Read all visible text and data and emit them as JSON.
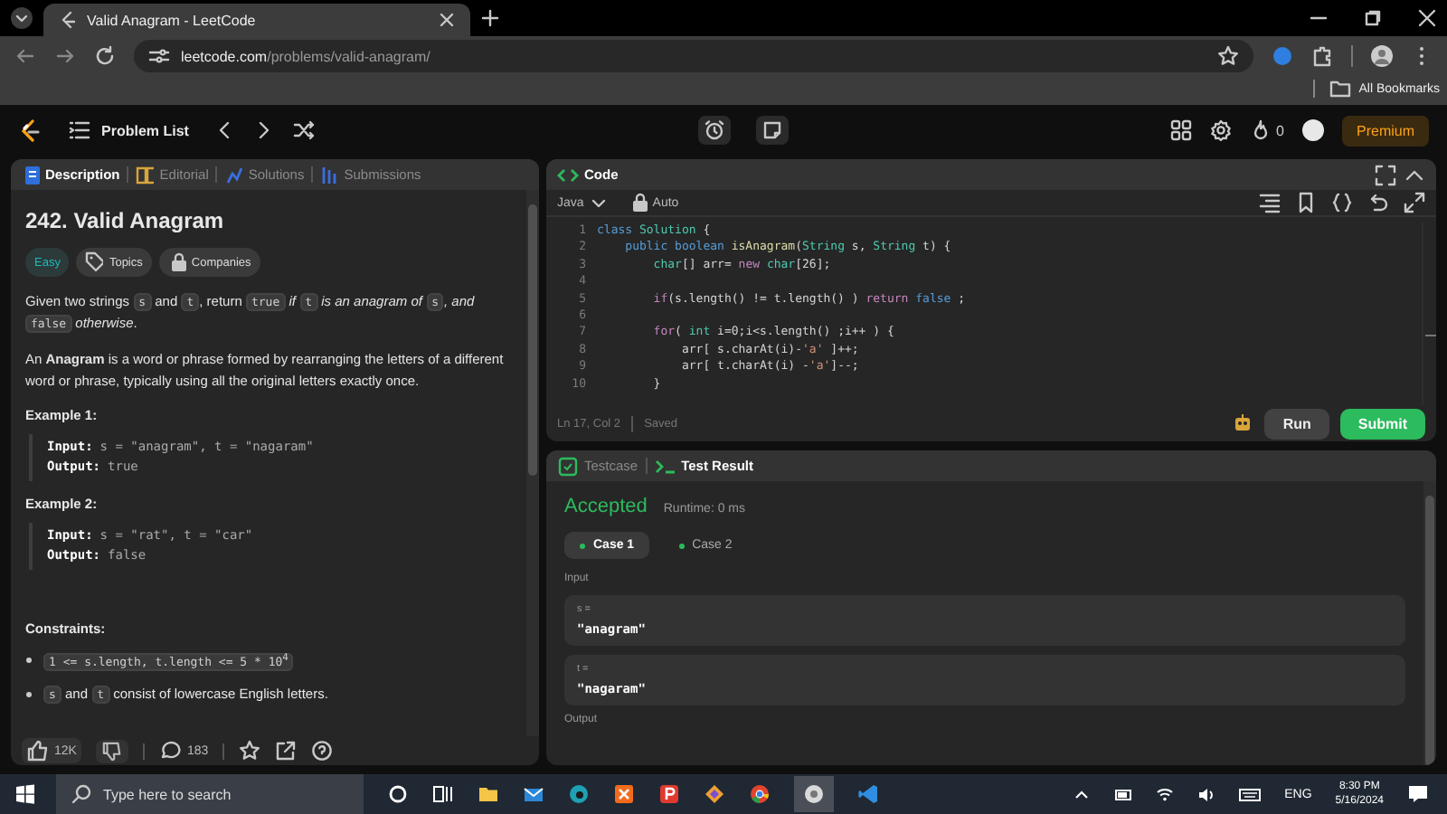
{
  "browser": {
    "tabs": [
      {
        "title": "Valid Anagram - LeetCode",
        "selected": true
      }
    ],
    "address": {
      "host": "leetcode.com",
      "path": "/problems/valid-anagram/"
    },
    "bookmarks_label": "All Bookmarks"
  },
  "nav": {
    "title": "Problem List",
    "streak": "0",
    "premium": "Premium"
  },
  "description": {
    "tabs": [
      {
        "label": "Description",
        "selected": true
      },
      {
        "label": "Editorial",
        "selected": false
      },
      {
        "label": "Solutions",
        "selected": false
      },
      {
        "label": "Submissions",
        "selected": false
      }
    ],
    "title": "242. Valid Anagram",
    "difficulty": "Easy",
    "tags": [
      "Topics",
      "Companies"
    ],
    "paragraphs": [
      [
        {
          "kind": "text",
          "text": "Given two strings "
        },
        {
          "kind": "code",
          "text": "s"
        },
        {
          "kind": "text",
          "text": " and "
        },
        {
          "kind": "code",
          "text": "t"
        },
        {
          "kind": "text",
          "text": ", return "
        },
        {
          "kind": "code",
          "text": "true"
        },
        {
          "kind": "text",
          "text": " *if* "
        },
        {
          "kind": "code",
          "text": "t"
        },
        {
          "kind": "text",
          "text": " *is an anagram of* "
        },
        {
          "kind": "code",
          "text": "s"
        },
        {
          "kind": "text",
          "text": "*, and* "
        },
        {
          "kind": "code",
          "text": "false"
        },
        {
          "kind": "text",
          "text": " *otherwise*."
        }
      ],
      [
        {
          "kind": "text",
          "text": "An **Anagram** is a word or phrase formed by rearranging the letters of a different word or phrase, typically using all the original letters exactly once."
        }
      ]
    ],
    "examples": [
      {
        "heading": "Example 1:",
        "lines": [
          {
            "label": "Input:",
            "value": "s = \"anagram\", t = \"nagaram\""
          },
          {
            "label": "Output:",
            "value": "true"
          }
        ]
      },
      {
        "heading": "Example 2:",
        "lines": [
          {
            "label": "Input:",
            "value": "s = \"rat\", t = \"car\""
          },
          {
            "label": "Output:",
            "value": "false"
          }
        ]
      }
    ],
    "constraints_heading": "Constraints:",
    "constraints": [
      [
        {
          "kind": "code",
          "text": "1 <= s.length, t.length <= 5 * 10$^{4}$"
        }
      ],
      [
        {
          "kind": "code",
          "text": "s"
        },
        {
          "kind": "text",
          "text": " and "
        },
        {
          "kind": "code",
          "text": "t"
        },
        {
          "kind": "text",
          "text": " consist of lowercase English letters."
        }
      ]
    ],
    "footer": {
      "likes": "12K",
      "comments": "183"
    }
  },
  "editor": {
    "title": "Code",
    "language": "Java",
    "mode": "Auto",
    "lines": [
      {
        "number": "1",
        "tokens": [
          {
            "kind": "kw",
            "text": "class "
          },
          {
            "kind": "type",
            "text": "Solution"
          },
          {
            "kind": "plain",
            "text": " {"
          }
        ]
      },
      {
        "number": "2",
        "tokens": [
          {
            "kind": "kw",
            "text": "    public boolean "
          },
          {
            "kind": "fn",
            "text": "isAnagram"
          },
          {
            "kind": "plain",
            "text": "("
          },
          {
            "kind": "type",
            "text": "String"
          },
          {
            "kind": "plain",
            "text": " s, "
          },
          {
            "kind": "type",
            "text": "String"
          },
          {
            "kind": "plain",
            "text": " t) {"
          }
        ]
      },
      {
        "number": "3",
        "tokens": [
          {
            "kind": "type",
            "text": "        char"
          },
          {
            "kind": "plain",
            "text": "[] arr= "
          },
          {
            "kind": "ctrl",
            "text": "new "
          },
          {
            "kind": "type",
            "text": "char"
          },
          {
            "kind": "plain",
            "text": "[26];"
          }
        ]
      },
      {
        "number": "4"
      },
      {
        "number": "5",
        "tokens": [
          {
            "kind": "ctrl",
            "text": "        if"
          },
          {
            "kind": "plain",
            "text": "(s.length() != t.length() ) "
          },
          {
            "kind": "ctrl",
            "text": "return "
          },
          {
            "kind": "kw",
            "text": "false"
          },
          {
            "kind": "plain",
            "text": " ;"
          }
        ]
      },
      {
        "number": "6"
      },
      {
        "number": "7",
        "tokens": [
          {
            "kind": "ctrl",
            "text": "        for"
          },
          {
            "kind": "plain",
            "text": "( "
          },
          {
            "kind": "type",
            "text": "int"
          },
          {
            "kind": "plain",
            "text": " i=0;i<s.length() ;i++ ) {"
          }
        ]
      },
      {
        "number": "8",
        "tokens": [
          {
            "kind": "plain",
            "text": "            arr[ s.charAt(i)-"
          },
          {
            "kind": "str",
            "text": "'a'"
          },
          {
            "kind": "plain",
            "text": " ]++;"
          }
        ]
      },
      {
        "number": "9",
        "tokens": [
          {
            "kind": "plain",
            "text": "            arr[ t.charAt(i) -"
          },
          {
            "kind": "str",
            "text": "'a'"
          },
          {
            "kind": "plain",
            "text": "]--;"
          }
        ]
      },
      {
        "number": "10",
        "tokens": [
          {
            "kind": "plain",
            "text": "        }"
          }
        ]
      }
    ],
    "status": "Ln 17, Col 2",
    "saved": "Saved",
    "run": "Run",
    "submit": "Submit"
  },
  "results": {
    "tabs": [
      {
        "label": "Testcase",
        "selected": false
      },
      {
        "label": "Test Result",
        "selected": true
      }
    ],
    "verdict": "Accepted",
    "runtime": "Runtime: 0 ms",
    "cases": [
      {
        "label": "Case 1",
        "selected": true
      },
      {
        "label": "Case 2",
        "selected": false
      }
    ],
    "input_label": "Input",
    "inputs": [
      {
        "name": "s =",
        "value": "\"anagram\""
      },
      {
        "name": "t =",
        "value": "\"nagaram\""
      }
    ],
    "output_label": "Output"
  },
  "taskbar": {
    "search_placeholder": "Type here to search",
    "language": "ENG",
    "time": "8:30 PM",
    "date": "5/16/2024"
  }
}
